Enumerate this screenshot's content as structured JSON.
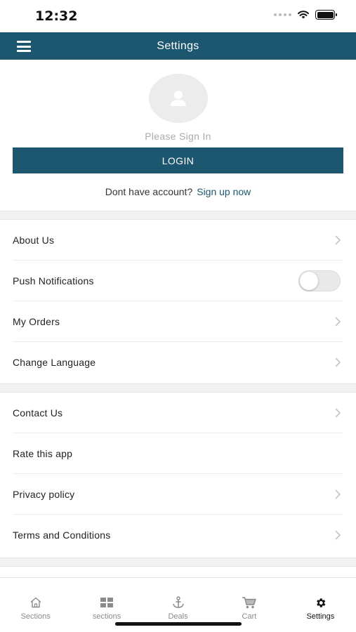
{
  "status_bar": {
    "time": "12:32"
  },
  "nav": {
    "title": "Settings"
  },
  "profile": {
    "sign_in_text": "Please Sign In",
    "login_label": "LOGIN",
    "signup_prompt": "Dont have account?",
    "signup_link": "Sign up now"
  },
  "sections": [
    {
      "items": [
        {
          "label": "About Us",
          "control": "chevron"
        },
        {
          "label": "Push Notifications",
          "control": "toggle",
          "on": false
        },
        {
          "label": "My Orders",
          "control": "chevron"
        },
        {
          "label": "Change Language",
          "control": "chevron"
        }
      ]
    },
    {
      "items": [
        {
          "label": "Contact Us",
          "control": "chevron"
        },
        {
          "label": "Rate this app",
          "control": "none"
        },
        {
          "label": "Privacy policy",
          "control": "chevron"
        },
        {
          "label": "Terms and Conditions",
          "control": "chevron"
        }
      ]
    }
  ],
  "tabs": [
    {
      "label": "Sections",
      "icon": "home-icon",
      "active": false
    },
    {
      "label": "sections",
      "icon": "grid-icon",
      "active": false
    },
    {
      "label": "Deals",
      "icon": "anchor-icon",
      "active": false
    },
    {
      "label": "Cart",
      "icon": "cart-icon",
      "active": false
    },
    {
      "label": "Settings",
      "icon": "gear-icon",
      "active": true
    }
  ],
  "colors": {
    "brand": "#1c566f",
    "inactive_tab": "#8a8a8a",
    "active_tab": "#111111"
  }
}
